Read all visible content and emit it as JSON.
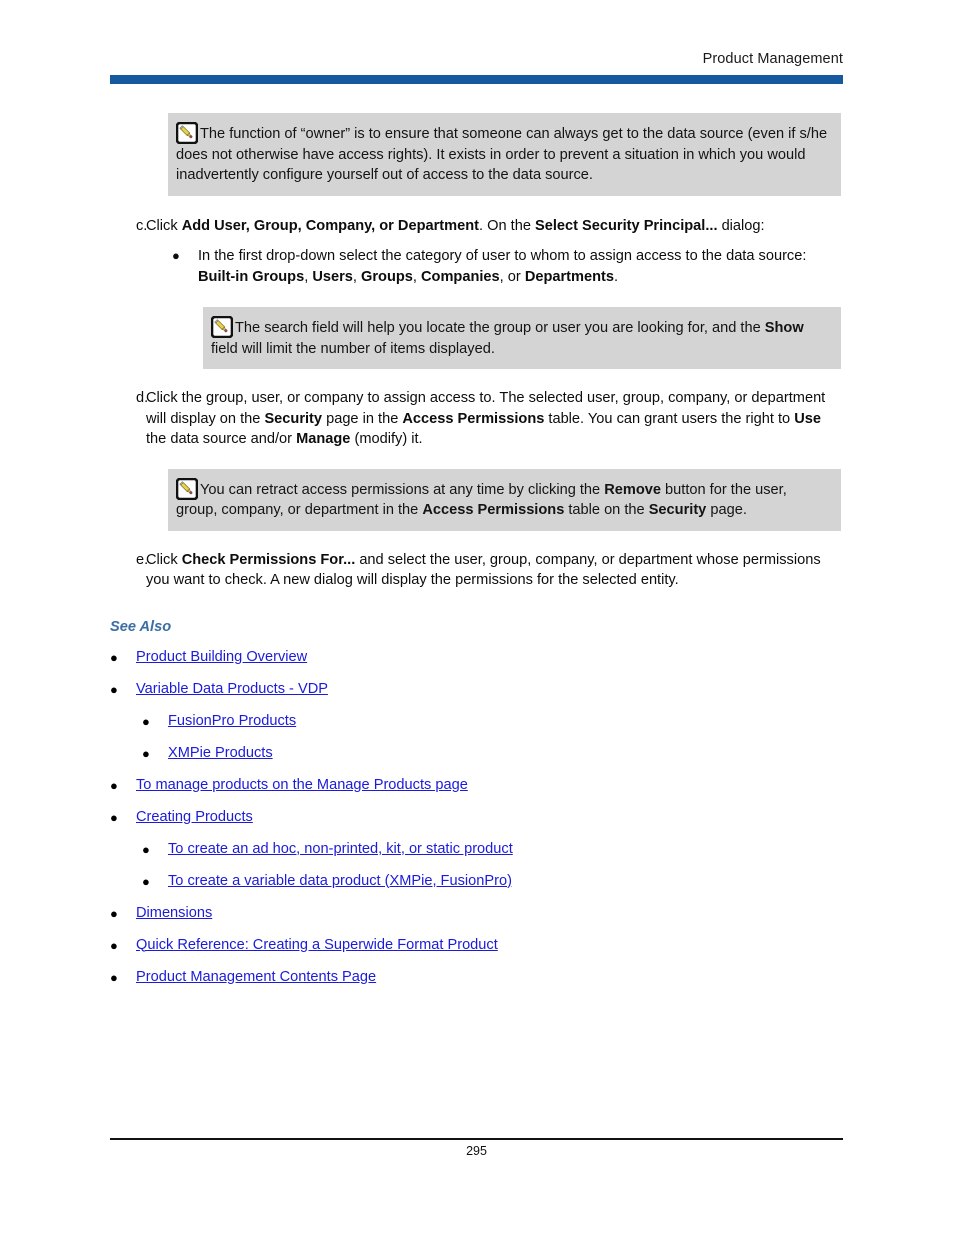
{
  "header": {
    "title": "Product Management",
    "rule_color": "#17599F"
  },
  "notes": [
    {
      "icon": "pencil-note-icon",
      "segments": [
        {
          "text": "The function of “owner” is to ensure that someone can always get to the data source (even if s/he does not otherwise have access rights). It exists in order to prevent a situation in which you would inadvertently configure yourself out of access to the data source.",
          "bold": false
        }
      ]
    },
    {
      "icon": "pencil-note-icon",
      "segments": [
        {
          "text": "The search field will help you locate the group or user you are looking for, and the ",
          "bold": false
        },
        {
          "text": "Show",
          "bold": true
        },
        {
          "text": " field will limit the number of items displayed.",
          "bold": false
        }
      ]
    },
    {
      "icon": "pencil-note-icon",
      "segments": [
        {
          "text": "You can retract access permissions at any time by clicking the ",
          "bold": false
        },
        {
          "text": "Remove",
          "bold": true
        },
        {
          "text": " button for the user, group, company, or department in the ",
          "bold": false
        },
        {
          "text": "Access Permissions",
          "bold": true
        },
        {
          "text": " table on the ",
          "bold": false
        },
        {
          "text": "Security",
          "bold": true
        },
        {
          "text": " page.",
          "bold": false
        }
      ]
    }
  ],
  "steps": [
    {
      "marker": "c.",
      "segments": [
        {
          "text": "Click ",
          "bold": false
        },
        {
          "text": "Add User, Group, Company, or Department",
          "bold": true
        },
        {
          "text": ". On the ",
          "bold": false
        },
        {
          "text": "Select Security Principal...",
          "bold": true
        },
        {
          "text": " dialog:",
          "bold": false
        }
      ]
    },
    {
      "marker": "d.",
      "segments": [
        {
          "text": "Click the group, user, or company to assign access to. The selected user, group, company, or department will display on the ",
          "bold": false
        },
        {
          "text": "Security",
          "bold": true
        },
        {
          "text": " page in the ",
          "bold": false
        },
        {
          "text": "Access Permissions",
          "bold": true
        },
        {
          "text": " table. You can grant users the right to ",
          "bold": false
        },
        {
          "text": "Use",
          "bold": true
        },
        {
          "text": " the data source and/or ",
          "bold": false
        },
        {
          "text": "Manage",
          "bold": true
        },
        {
          "text": " (modify) it.",
          "bold": false
        }
      ]
    },
    {
      "marker": "e.",
      "segments": [
        {
          "text": "Click ",
          "bold": false
        },
        {
          "text": "Check Permissions For...",
          "bold": true
        },
        {
          "text": " and select the user, group, company, or department whose permissions you want to check. A new dialog will display the permissions for the selected entity.",
          "bold": false
        }
      ]
    }
  ],
  "sub_bullet": {
    "segments": [
      {
        "text": "In the first drop-down select the category of user to whom to assign access to the data source: ",
        "bold": false
      },
      {
        "text": "Built-in Groups",
        "bold": true
      },
      {
        "text": ", ",
        "bold": false
      },
      {
        "text": "Users",
        "bold": true
      },
      {
        "text": ", ",
        "bold": false
      },
      {
        "text": "Groups",
        "bold": true
      },
      {
        "text": ", ",
        "bold": false
      },
      {
        "text": "Companies",
        "bold": true
      },
      {
        "text": ", or ",
        "bold": false
      },
      {
        "text": "Departments",
        "bold": true
      },
      {
        "text": ".",
        "bold": false
      }
    ]
  },
  "see_also": {
    "heading": "See Also",
    "heading_color": "#3B6EA5",
    "link_color": "#1B1BDB",
    "links": [
      {
        "label": "Product Building Overview",
        "level": 1
      },
      {
        "label": "Variable Data Products - VDP",
        "level": 1
      },
      {
        "label": "FusionPro Products",
        "level": 2
      },
      {
        "label": "XMPie Products",
        "level": 2
      },
      {
        "label": "To manage products on the Manage Products page",
        "level": 1
      },
      {
        "label": "Creating Products",
        "level": 1
      },
      {
        "label": "To create an ad hoc, non-printed, kit,  or static product",
        "level": 2
      },
      {
        "label": "To create a variable data product (XMPie, FusionPro)",
        "level": 2
      },
      {
        "label": "Dimensions",
        "level": 1
      },
      {
        "label": "Quick Reference: Creating a Superwide Format Product",
        "level": 1
      },
      {
        "label": "Product Management Contents Page",
        "level": 1
      }
    ]
  },
  "footer": {
    "page_number": "295"
  },
  "bullet_glyph": "●"
}
